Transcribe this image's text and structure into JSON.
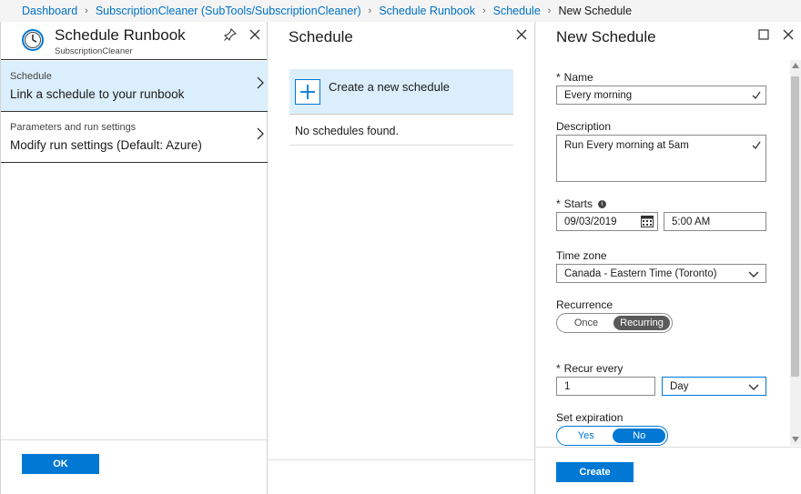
{
  "breadcrumb": {
    "items": [
      "Dashboard",
      "SubscriptionCleaner (SubTools/SubscriptionCleaner)",
      "Schedule Runbook",
      "Schedule"
    ],
    "current": "New Schedule"
  },
  "runbook_blade": {
    "title": "Schedule Runbook",
    "subtitle": "SubscriptionCleaner",
    "items": [
      {
        "category": "Schedule",
        "description": "Link a schedule to your runbook"
      },
      {
        "category": "Parameters and run settings",
        "description": "Modify run settings (Default: Azure)"
      }
    ],
    "ok_label": "OK"
  },
  "schedule_blade": {
    "title": "Schedule",
    "create_label": "Create a new schedule",
    "empty_text": "No schedules found."
  },
  "new_schedule_blade": {
    "title": "New Schedule",
    "name_label": "Name",
    "name_value": "Every morning",
    "description_label": "Description",
    "description_value": "Run Every morning at 5am",
    "starts_label": "Starts",
    "start_date": "09/03/2019",
    "start_time": "5:00 AM",
    "timezone_label": "Time zone",
    "timezone_value": "Canada - Eastern Time (Toronto)",
    "recurrence_label": "Recurrence",
    "recurrence_options": [
      "Once",
      "Recurring"
    ],
    "recurrence_selected": "Recurring",
    "recur_every_label": "Recur every",
    "recur_every_value": "1",
    "recur_unit": "Day",
    "expiration_label": "Set expiration",
    "expiration_options": [
      "Yes",
      "No"
    ],
    "expiration_selected": "No",
    "create_label": "Create"
  },
  "colors": {
    "accent": "#0078d4",
    "link": "#0072c6",
    "selected_bg": "#dbeefb"
  }
}
